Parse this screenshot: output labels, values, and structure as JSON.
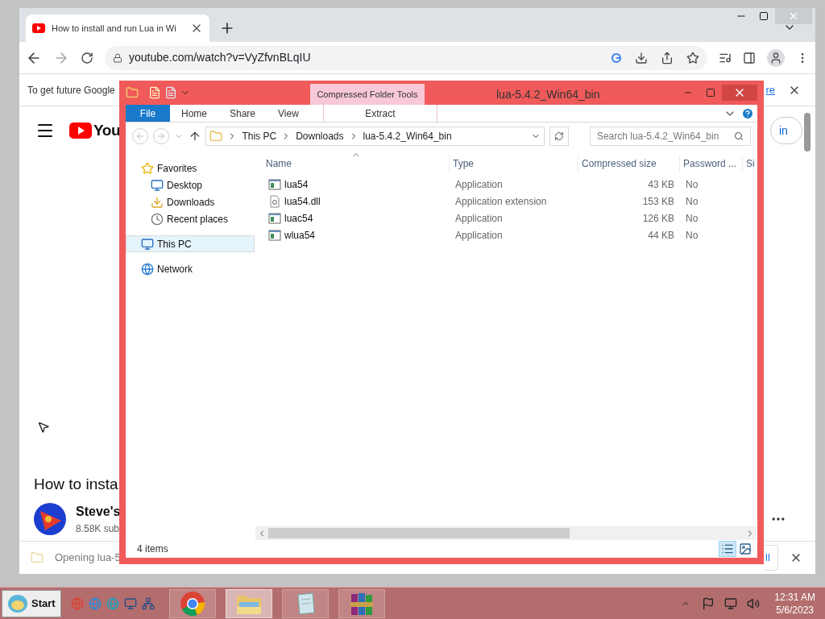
{
  "browser": {
    "tab": {
      "title": "How to install and run Lua in Wi"
    },
    "address": "youtube.com/watch?v=VyZfvnBLqIU",
    "infobar": {
      "text": "To get future Google",
      "link": "re"
    },
    "page": {
      "logo_text": "You",
      "sign_in": "in",
      "video_title": "How to insta",
      "channel": "Steve's",
      "subscribers": "8.58K sub"
    },
    "download_bar": {
      "file": "Opening lua-5",
      "show_all": "ll"
    }
  },
  "explorer": {
    "title": "lua-5.4.2_Win64_bin",
    "context_header": "Compressed Folder Tools",
    "ribbon_tabs": [
      {
        "label": "File",
        "kind": "file"
      },
      {
        "label": "Home",
        "kind": "tab"
      },
      {
        "label": "Share",
        "kind": "tab"
      },
      {
        "label": "View",
        "kind": "tab"
      },
      {
        "label": "Extract",
        "kind": "context"
      }
    ],
    "breadcrumb": [
      "This PC",
      "Downloads",
      "lua-5.4.2_Win64_bin"
    ],
    "search": {
      "placeholder": "Search lua-5.4.2_Win64_bin"
    },
    "nav": [
      {
        "label": "Favorites",
        "kind": "star",
        "selected": false,
        "children": [
          {
            "label": "Desktop",
            "kind": "desktop",
            "selected": false
          },
          {
            "label": "Downloads",
            "kind": "downloads",
            "selected": false
          },
          {
            "label": "Recent places",
            "kind": "recent",
            "selected": false
          }
        ]
      },
      {
        "label": "This PC",
        "kind": "pc",
        "selected": true
      },
      {
        "label": "Network",
        "kind": "network",
        "selected": false
      }
    ],
    "columns": [
      "Name",
      "Type",
      "Compressed size",
      "Password ...",
      "Si"
    ],
    "rows": [
      {
        "name": "lua54",
        "kind": "app",
        "type": "Application",
        "size": "43 KB",
        "password": "No"
      },
      {
        "name": "lua54.dll",
        "kind": "dll",
        "type": "Application extension",
        "size": "153 KB",
        "password": "No"
      },
      {
        "name": "luac54",
        "kind": "app",
        "type": "Application",
        "size": "126 KB",
        "password": "No"
      },
      {
        "name": "wlua54",
        "kind": "app",
        "type": "Application",
        "size": "44 KB",
        "password": "No"
      }
    ],
    "status": "4 items",
    "views": [
      {
        "kind": "details",
        "selected": true
      },
      {
        "kind": "large",
        "selected": false
      }
    ]
  },
  "taskbar": {
    "start": "Start",
    "tasks": [
      {
        "kind": "chrome",
        "active": false
      },
      {
        "kind": "explorer",
        "active": true
      },
      {
        "kind": "notepad",
        "active": false
      },
      {
        "kind": "winrar",
        "active": false
      }
    ],
    "time": "12:31 AM",
    "date": "5/6/2023"
  }
}
